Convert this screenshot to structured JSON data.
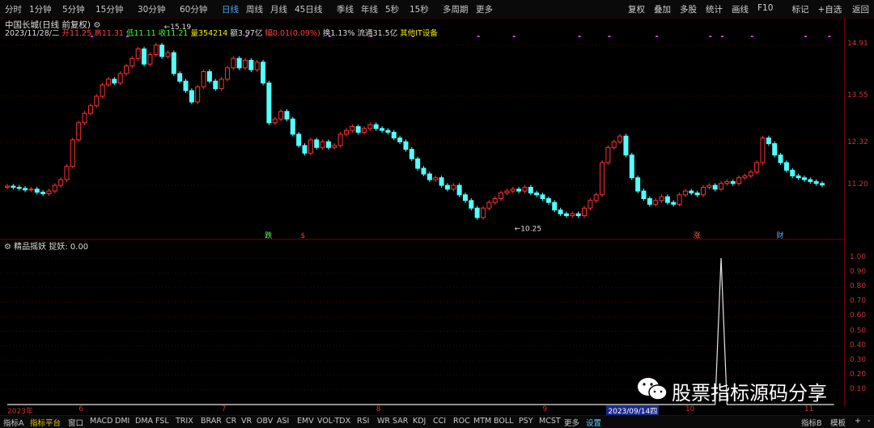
{
  "toolbar": {
    "timeframes": [
      "分时",
      "1分钟",
      "5分钟",
      "15分钟",
      "30分钟",
      "60分钟",
      "日线",
      "周线",
      "月线",
      "45日线",
      "季线",
      "年线",
      "5秒",
      "15秒",
      "多周期",
      "更多"
    ],
    "active": "日线",
    "right_buttons": [
      "复权",
      "叠加",
      "多股",
      "统计",
      "画线",
      "F10",
      "标记",
      "+自选",
      "返回"
    ]
  },
  "stock": {
    "name": "中国长城(日线 前复权)",
    "settings_icon": "gear-icon"
  },
  "quote": {
    "date": "2023/11/28/二",
    "open_label": "开",
    "open": "11.25",
    "high_label": "高",
    "high": "11.31",
    "low_label": "低",
    "low": "11.11",
    "close_label": "收",
    "close": "11.21",
    "vol_label": "量",
    "vol": "354214",
    "amt_label": "额",
    "amt": "3.97亿",
    "chg_label": "幅",
    "chg": "0.01(0.09%)",
    "turnover_label": "换",
    "turnover": "1.13%",
    "float_label": "流通",
    "float": "31.5亿",
    "other": "其他IT设备"
  },
  "indicator": {
    "name": "精品摇妖",
    "param_label": "捉妖:",
    "param_value": "0.00"
  },
  "bottom_tabs": [
    "指标A",
    "指标平台",
    "窗口",
    "MACD",
    "DMI",
    "DMA",
    "FSL",
    "TRIX",
    "BRAR",
    "CR",
    "VR",
    "OBV",
    "ASI",
    "EMV",
    "VOL-TDX",
    "RSI",
    "WR",
    "SAR",
    "KDJ",
    "CCI",
    "ROC",
    "MTM",
    "BOLL",
    "PSY",
    "MCST",
    "更多",
    "设置"
  ],
  "bottom_right": [
    "指标B",
    "模板",
    "+",
    "-"
  ],
  "watermark": "股票指标源码分享",
  "colors": {
    "up": "#ff3232",
    "down": "#54ffff",
    "grid": "#5a0000",
    "axis": "#c33",
    "line": "#e6e6e6",
    "active_tab": "#4aa3ff"
  },
  "chart_data": [
    {
      "type": "candlestick",
      "ylim": [
        9.9,
        15.45
      ],
      "y_ticks": [
        14.91,
        13.55,
        12.32,
        11.2
      ],
      "annotations": [
        {
          "text": "15.19",
          "value": 15.19,
          "index": 25,
          "kind": "high"
        },
        {
          "text": "10.25",
          "value": 10.25,
          "index": 85,
          "kind": "low"
        },
        {
          "text": "跌",
          "index": 44,
          "color": "#5f5"
        },
        {
          "text": "$",
          "index": 50,
          "color": "#f33"
        },
        {
          "text": "涨",
          "index": 116,
          "color": "#f55"
        },
        {
          "text": "财",
          "index": 130,
          "color": "#5af"
        }
      ],
      "x_labels": [
        {
          "text": "2023年",
          "index": 0
        },
        {
          "text": "6",
          "index": 12
        },
        {
          "text": "7",
          "index": 36
        },
        {
          "text": "8",
          "index": 62
        },
        {
          "text": "9",
          "index": 90
        },
        {
          "text": "2023/09/14四",
          "index": 101,
          "highlight": true
        },
        {
          "text": "10",
          "index": 114
        },
        {
          "text": "11",
          "index": 134
        }
      ],
      "close": [
        11.18,
        11.15,
        11.12,
        11.08,
        11.1,
        11.02,
        10.98,
        11.05,
        11.2,
        11.35,
        11.7,
        12.4,
        12.85,
        13.1,
        13.3,
        13.55,
        13.85,
        14.0,
        13.9,
        14.15,
        14.35,
        14.55,
        14.8,
        14.4,
        14.65,
        14.9,
        14.6,
        14.7,
        14.15,
        13.95,
        13.7,
        13.4,
        13.8,
        14.2,
        13.95,
        13.75,
        14.0,
        14.3,
        14.55,
        14.3,
        14.5,
        14.25,
        14.45,
        13.9,
        12.85,
        12.95,
        13.15,
        12.95,
        12.55,
        12.25,
        12.05,
        12.4,
        12.2,
        12.35,
        12.2,
        12.25,
        12.55,
        12.65,
        12.75,
        12.6,
        12.7,
        12.8,
        12.7,
        12.65,
        12.6,
        12.45,
        12.35,
        12.15,
        11.9,
        11.65,
        11.5,
        11.35,
        11.4,
        11.2,
        11.1,
        11.2,
        10.95,
        10.8,
        10.6,
        10.35,
        10.6,
        10.75,
        10.85,
        11.0,
        11.05,
        11.1,
        11.05,
        11.15,
        11.0,
        10.95,
        10.85,
        10.75,
        10.55,
        10.45,
        10.4,
        10.45,
        10.4,
        10.6,
        10.8,
        10.95,
        11.8,
        12.2,
        12.35,
        12.5,
        12.0,
        11.4,
        11.05,
        10.85,
        10.7,
        10.8,
        10.9,
        10.75,
        10.7,
        10.95,
        11.05,
        11.0,
        10.95,
        11.15,
        11.2,
        11.1,
        11.25,
        11.3,
        11.25,
        11.4,
        11.45,
        11.55,
        11.8,
        12.45,
        12.3,
        12.0,
        11.8,
        11.6,
        11.45,
        11.4,
        11.35,
        11.3,
        11.25,
        11.21
      ],
      "ohlc_rule": "open = previous close; wick 0.06 beyond body"
    },
    {
      "type": "line",
      "ylim": [
        0,
        1.05
      ],
      "y_ticks": [
        1.0,
        0.9,
        0.8,
        0.7,
        0.6,
        0.5,
        0.4,
        0.3,
        0.2,
        0.1
      ],
      "x": [
        0,
        119,
        120,
        121,
        139
      ],
      "values": [
        0,
        0,
        1,
        0,
        0
      ]
    }
  ]
}
